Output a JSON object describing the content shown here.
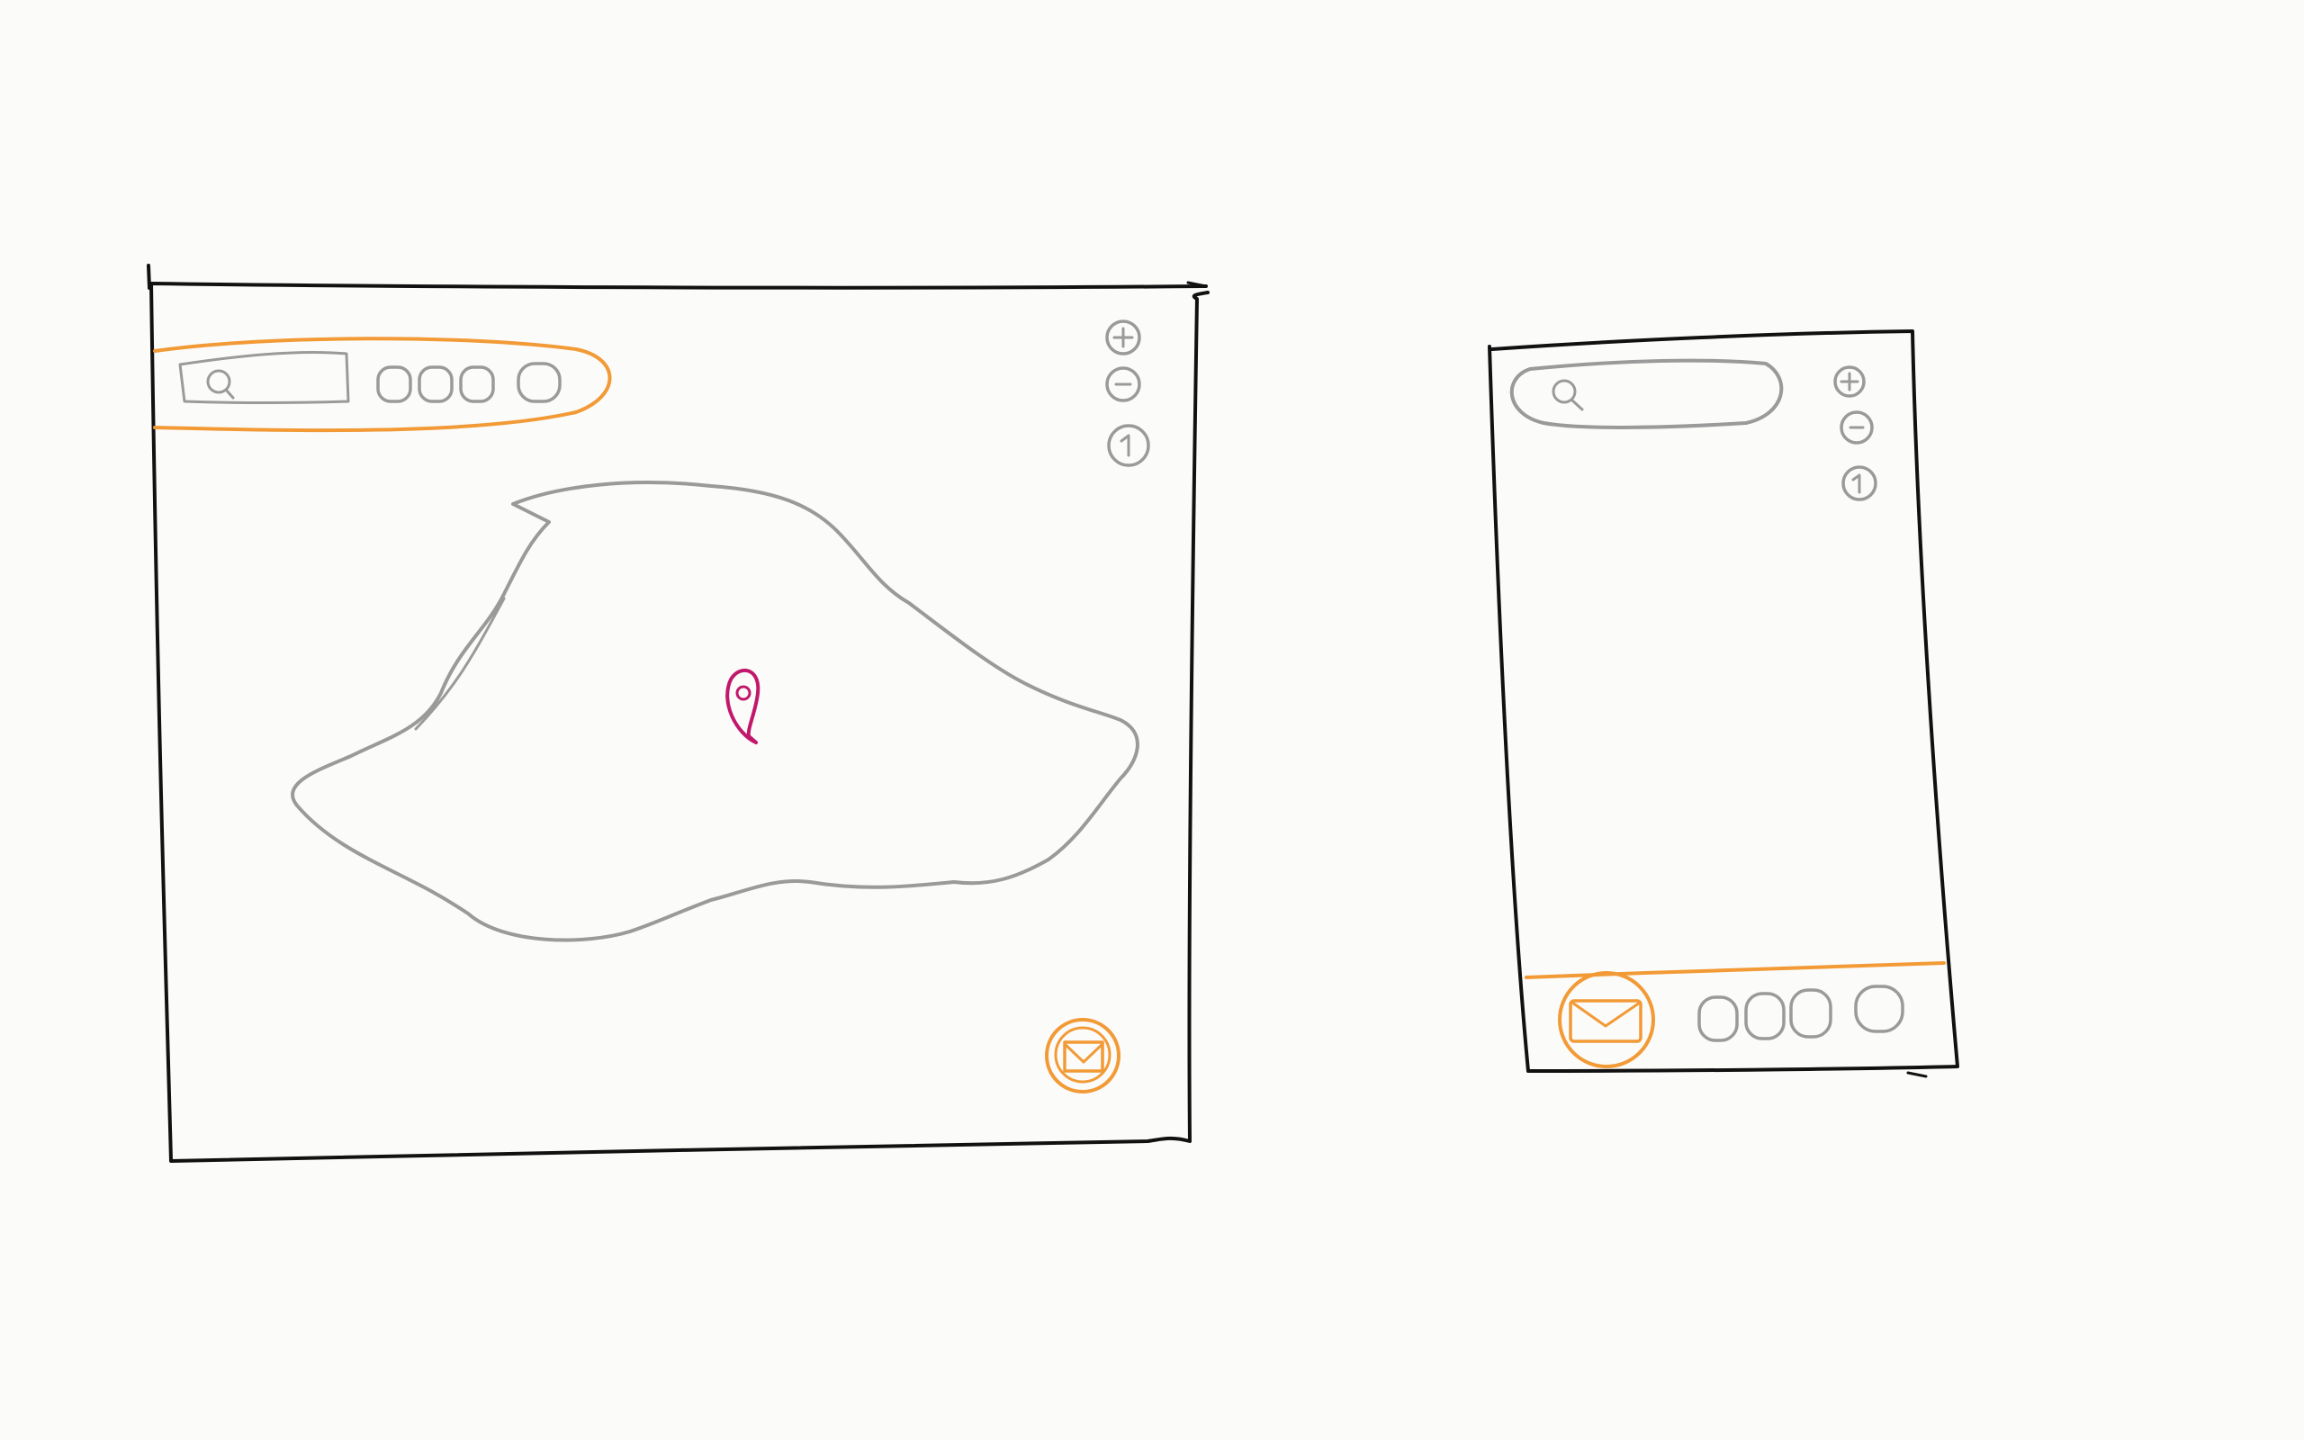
{
  "sketch": {
    "style": "hand-drawn wireframe",
    "frames": [
      {
        "id": "desktop",
        "label": "",
        "elements": {
          "search": {
            "icon": "search-icon",
            "highlight": "orange"
          },
          "toolbar_buttons": 4,
          "zoom_controls": [
            "plus-icon",
            "minus-icon",
            "locate-icon"
          ],
          "map_region": {
            "pin": "map-pin-icon"
          },
          "fab": {
            "icon": "mail-icon",
            "highlight": "orange"
          }
        }
      },
      {
        "id": "mobile",
        "label": "",
        "elements": {
          "search": {
            "icon": "search-icon"
          },
          "zoom_controls": [
            "plus-icon",
            "minus-icon",
            "locate-icon"
          ],
          "bottom_bar": {
            "primary": "mail-icon",
            "buttons": 4,
            "highlight": "orange"
          }
        }
      }
    ],
    "colors": {
      "frame": "#111111",
      "ui": "#9a9a9a",
      "highlight": "#f29a36",
      "pin": "#c2186b",
      "paper": "#fbfbfa"
    }
  }
}
